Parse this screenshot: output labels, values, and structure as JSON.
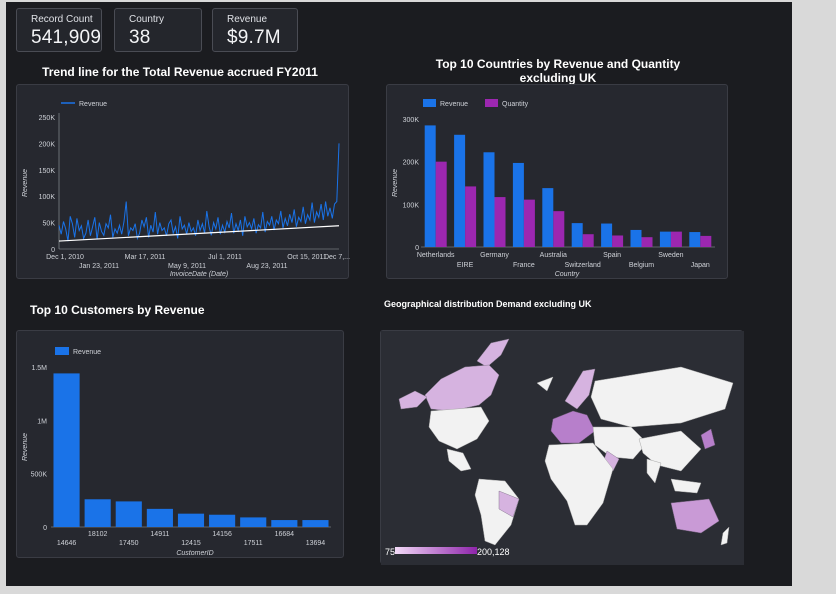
{
  "kpis": [
    {
      "label": "Record Count",
      "value": "541,909"
    },
    {
      "label": "Country",
      "value": "38"
    },
    {
      "label": "Revenue",
      "value": "$9.7M"
    }
  ],
  "charts": {
    "trend_title": "Trend line for the Total Revenue accrued FY2011",
    "countries_title": "Top 10 Countries by Revenue and Quantity excluding UK",
    "customers_title": "Top 10 Customers by Revenue",
    "map_title": "Geographical distribution Demand  excluding UK"
  },
  "colors": {
    "revenue": "#1a73e8",
    "quantity": "#9c27b0",
    "map_low": "#e1c4e9",
    "map_high": "#8e24aa"
  },
  "map": {
    "legend_min": "75",
    "legend_max": "200,128"
  },
  "chart_data": [
    {
      "type": "line",
      "title": "Trend line for the Total Revenue accrued FY2011",
      "xlabel": "InvoiceDate (Date)",
      "ylabel": "Revenue",
      "legend": [
        "Revenue"
      ],
      "legend_position": "top-left",
      "ylim": [
        0,
        250000
      ],
      "yticks": [
        "0",
        "50K",
        "100K",
        "150K",
        "200K",
        "250K"
      ],
      "xticks_row1": [
        "Dec 1, 2010",
        "Mar 17, 2011",
        "Jul 1, 2011",
        "Oct 15, 2011",
        "Dec 7,..."
      ],
      "xticks_row2": [
        "Jan 23, 2011",
        "May 9, 2011",
        "Aug 23, 2011"
      ],
      "trendline": [
        15000,
        44000
      ],
      "series": [
        {
          "name": "Revenue",
          "values": [
            45000,
            28000,
            52000,
            38000,
            15000,
            62000,
            48000,
            22000,
            58000,
            35000,
            44000,
            20000,
            30000,
            55000,
            25000,
            42000,
            60000,
            18000,
            50000,
            33000,
            26000,
            48000,
            40000,
            65000,
            22000,
            38000,
            30000,
            45000,
            28000,
            52000,
            90000,
            25000,
            40000,
            35000,
            48000,
            20000,
            30000,
            55000,
            42000,
            60000,
            22000,
            45000,
            32000,
            70000,
            28000,
            50000,
            35000,
            40000,
            25000,
            48000,
            55000,
            30000,
            42000,
            20000,
            62000,
            38000,
            45000,
            28000,
            50000,
            33000,
            40000,
            25000,
            55000,
            35000,
            48000,
            30000,
            72000,
            42000,
            26000,
            50000,
            38000,
            60000,
            28000,
            45000,
            32000,
            52000,
            40000,
            68000,
            30000,
            48000,
            35000,
            55000,
            25000,
            62000,
            42000,
            50000,
            38000,
            58000,
            30000,
            46000,
            40000,
            70000,
            32000,
            52000,
            45000,
            62000,
            36000,
            55000,
            48000,
            72000,
            40000,
            58000,
            44000,
            66000,
            50000,
            75000,
            42000,
            60000,
            52000,
            80000,
            48000,
            65000,
            55000,
            88000,
            50000,
            70000,
            60000,
            85000,
            55000,
            90000,
            62000,
            78000,
            58000,
            85000,
            90000,
            200000
          ]
        }
      ]
    },
    {
      "type": "bar",
      "title": "Top 10 Countries by Revenue and Quantity excluding UK",
      "xlabel": "Country",
      "ylabel": "Revenue",
      "ylim": [
        0,
        300000
      ],
      "yticks": [
        "0",
        "100K",
        "200K",
        "300K"
      ],
      "legend_position": "top-left",
      "categories": [
        "Netherlands",
        "EIRE",
        "Germany",
        "France",
        "Australia",
        "Switzerland",
        "Spain",
        "Belgium",
        "Sweden",
        "Japan"
      ],
      "series": [
        {
          "name": "Revenue",
          "values": [
            285000,
            263000,
            222000,
            197000,
            138000,
            56000,
            55000,
            40000,
            36000,
            35000
          ]
        },
        {
          "name": "Quantity",
          "values": [
            200000,
            142000,
            117000,
            111000,
            84000,
            30000,
            27000,
            23000,
            36000,
            26000
          ]
        }
      ]
    },
    {
      "type": "bar",
      "title": "Top 10 Customers by Revenue",
      "xlabel": "CustomerID",
      "ylabel": "Revenue",
      "ylim": [
        0,
        1500000
      ],
      "yticks": [
        "0",
        "500K",
        "1M",
        "1.5M"
      ],
      "legend": [
        "Revenue"
      ],
      "legend_position": "top-left",
      "categories": [
        "14646",
        "18102",
        "17450",
        "14911",
        "12415",
        "14156",
        "17511",
        "16684",
        "13694"
      ],
      "values": [
        1440000,
        260000,
        240000,
        170000,
        125000,
        115000,
        90000,
        65000,
        65000
      ]
    }
  ]
}
